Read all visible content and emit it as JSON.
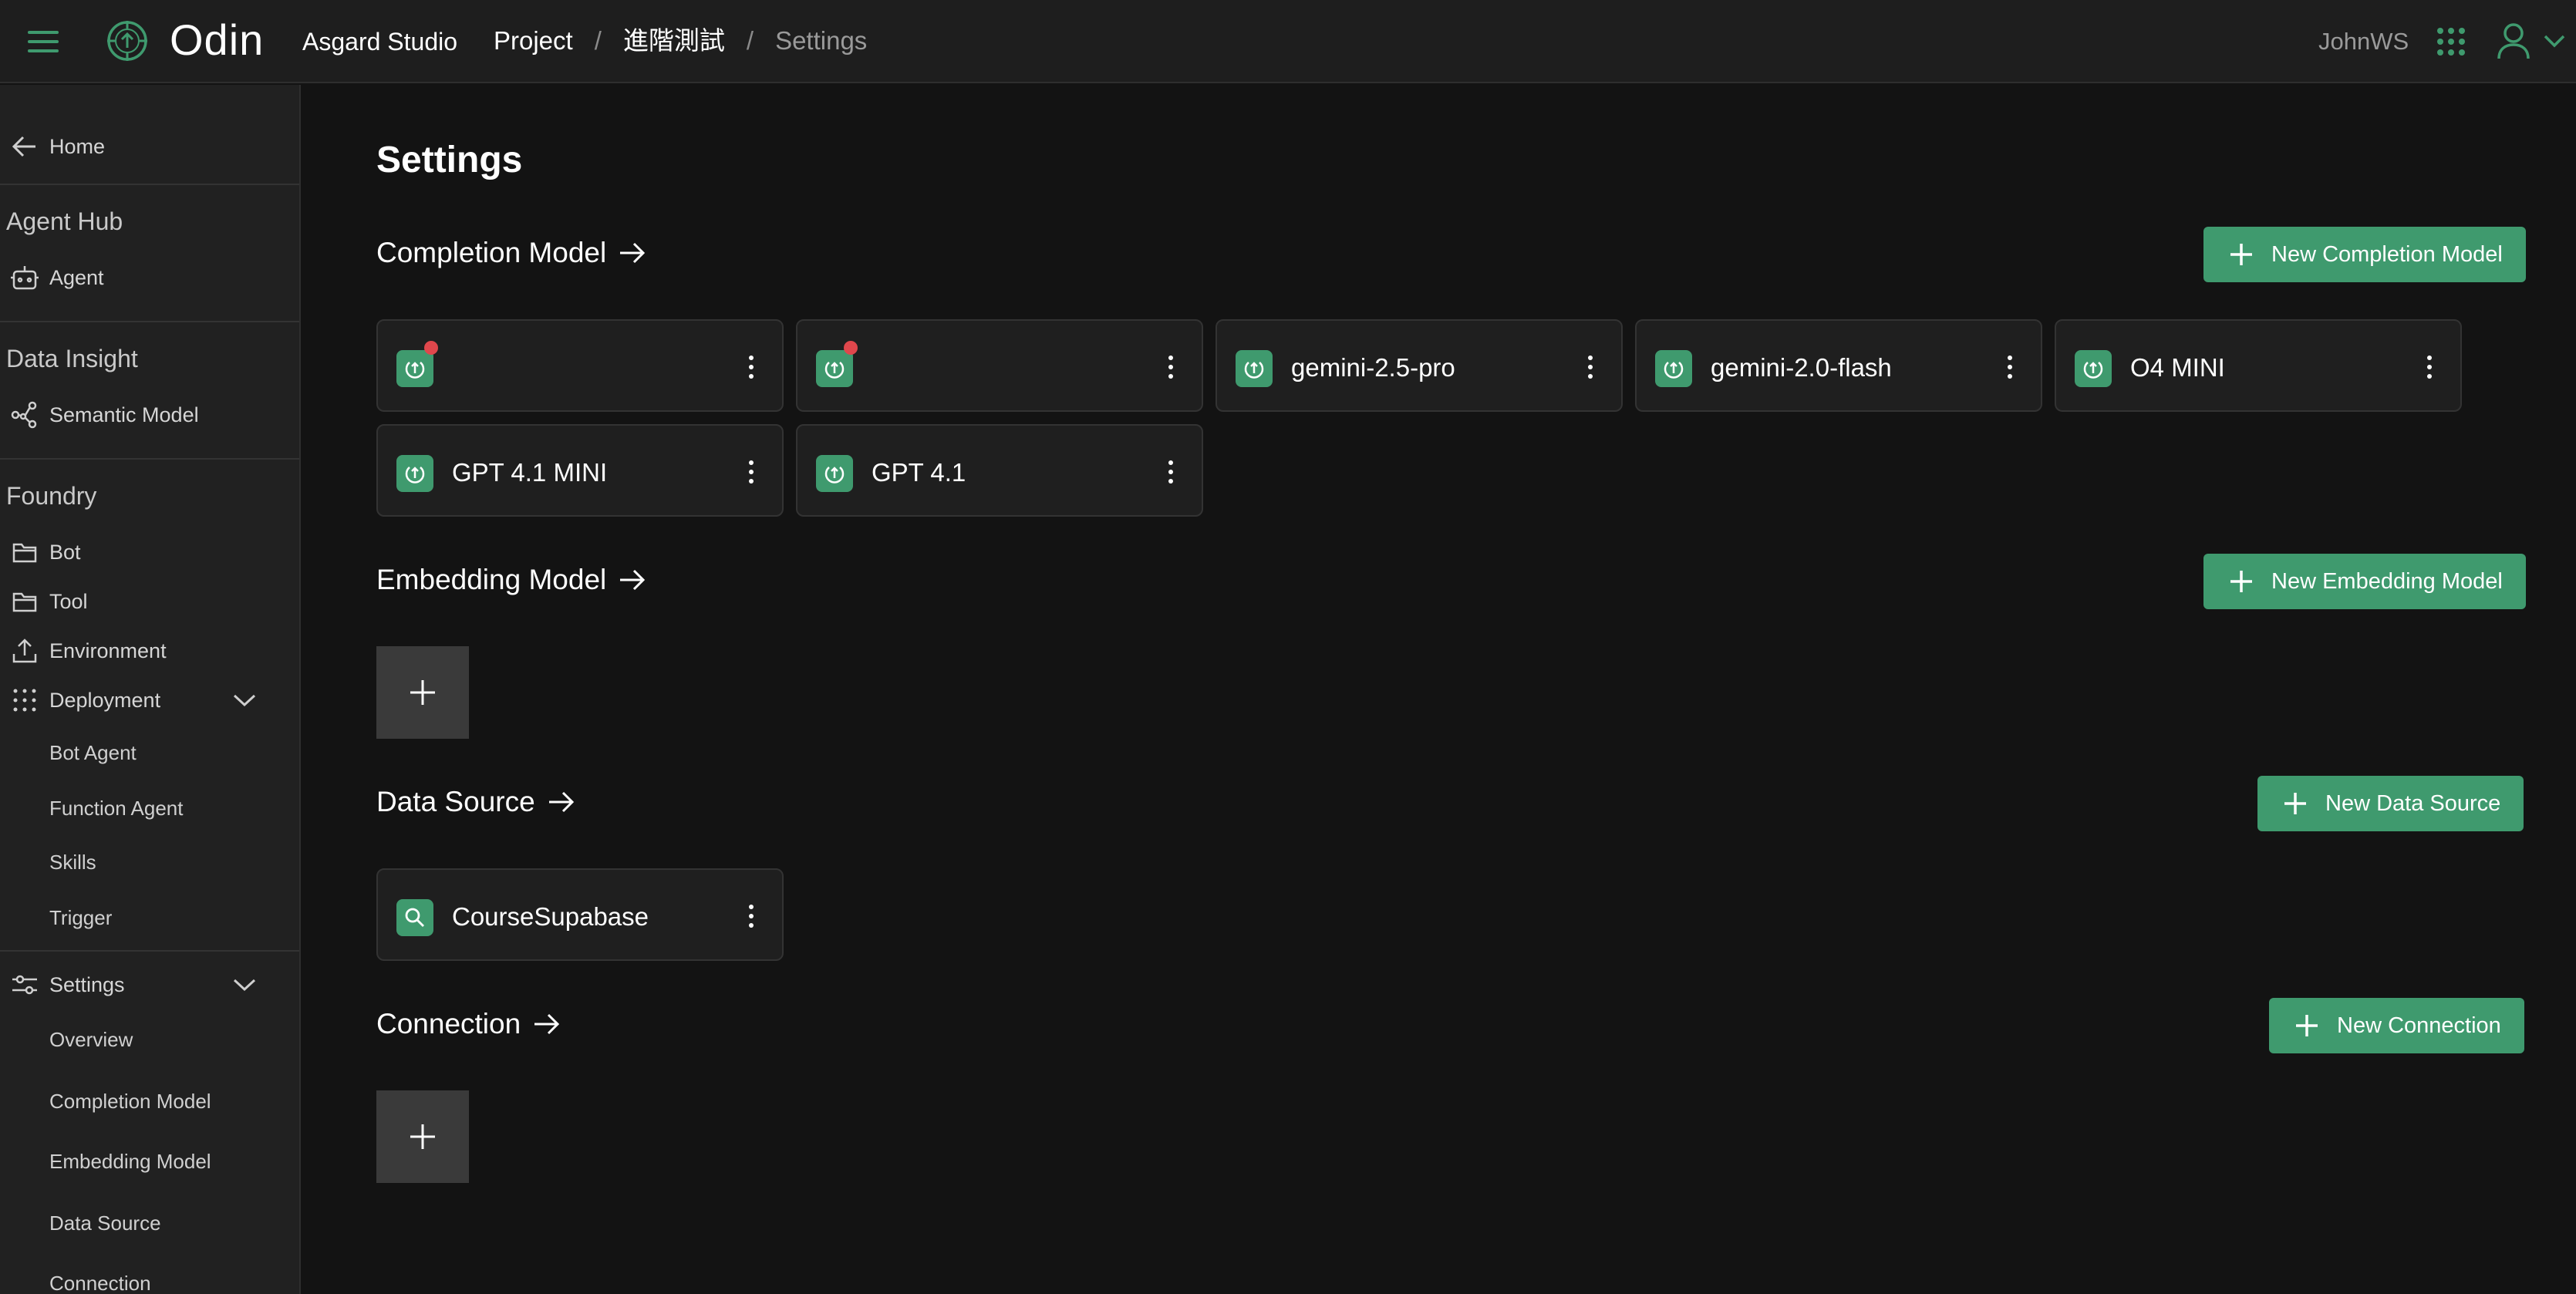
{
  "header": {
    "app_name": "Odin",
    "studio": "Asgard Studio",
    "breadcrumbs": [
      "Project",
      "進階測試",
      "Settings"
    ],
    "username": "JohnWS"
  },
  "sidebar": {
    "home": "Home",
    "agent_hub": {
      "title": "Agent Hub",
      "items": [
        "Agent"
      ]
    },
    "data_insight": {
      "title": "Data Insight",
      "items": [
        "Semantic Model"
      ]
    },
    "foundry": {
      "title": "Foundry",
      "items": [
        "Bot",
        "Tool",
        "Environment"
      ],
      "deployment": {
        "label": "Deployment",
        "children": [
          "Bot Agent",
          "Function Agent",
          "Skills",
          "Trigger"
        ]
      }
    },
    "settings": {
      "label": "Settings",
      "children": [
        "Overview",
        "Completion Model",
        "Embedding Model",
        "Data Source",
        "Connection"
      ]
    }
  },
  "main": {
    "title": "Settings",
    "completion": {
      "title": "Completion Model",
      "button": "New Completion Model",
      "cards": [
        {
          "name": "",
          "alert": true
        },
        {
          "name": "",
          "alert": true
        },
        {
          "name": "gemini-2.5-pro",
          "alert": false
        },
        {
          "name": "gemini-2.0-flash",
          "alert": false
        },
        {
          "name": "O4 MINI",
          "alert": false
        },
        {
          "name": "GPT 4.1 MINI",
          "alert": false
        },
        {
          "name": "GPT 4.1",
          "alert": false
        }
      ]
    },
    "embedding": {
      "title": "Embedding Model",
      "button": "New Embedding Model"
    },
    "datasource": {
      "title": "Data Source",
      "button": "New Data Source",
      "cards": [
        {
          "name": "CourseSupabase"
        }
      ]
    },
    "connection": {
      "title": "Connection",
      "button": "New Connection"
    }
  },
  "colors": {
    "accent": "#3f9a6e",
    "alert": "#e0474c",
    "background": "#131313",
    "sidebar": "#212121"
  },
  "icons": {
    "model": "model-icon",
    "datasource": "search-icon"
  }
}
